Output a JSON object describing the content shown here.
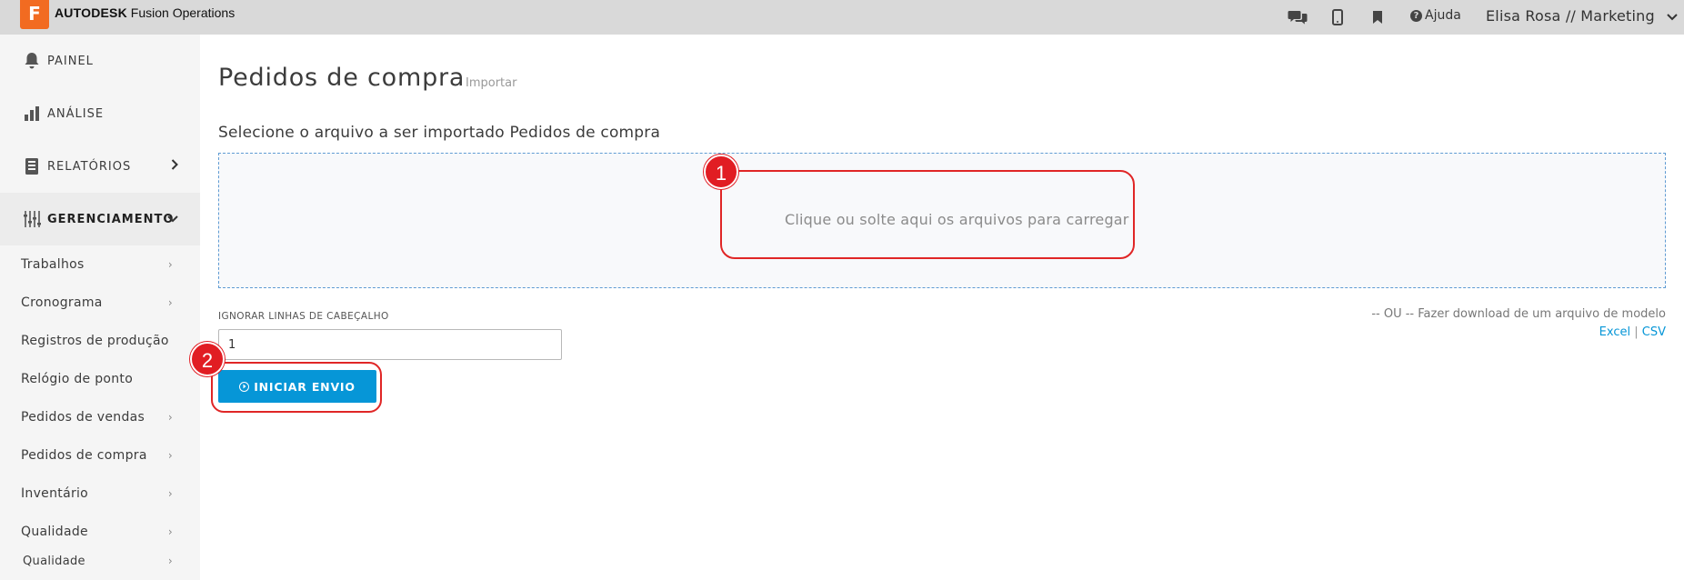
{
  "topbar": {
    "logo_letter": "F",
    "brand_main": "AUTODESK",
    "brand_product": "Fusion Operations",
    "help_label": "Ajuda",
    "user_label": "Elisa Rosa // Marketing",
    "icons": [
      "chat-icon",
      "mobile-icon",
      "bookmark-icon",
      "help-icon",
      "chevron-down-icon"
    ]
  },
  "sidebar": {
    "main": [
      {
        "label": "PAINEL",
        "icon": "bell-icon"
      },
      {
        "label": "ANÁLISE",
        "icon": "bar-chart-icon"
      },
      {
        "label": "RELATÓRIOS",
        "icon": "book-icon"
      },
      {
        "label": "GERENCIAMENTO",
        "icon": "sliders-icon"
      }
    ],
    "sub": [
      {
        "label": "Trabalhos",
        "arrow": true
      },
      {
        "label": "Cronograma",
        "arrow": true
      },
      {
        "label": "Registros de produção",
        "arrow": false
      },
      {
        "label": "Relógio de ponto",
        "arrow": false
      },
      {
        "label": "Pedidos de vendas",
        "arrow": true
      },
      {
        "label": "Pedidos de compra",
        "arrow": true
      },
      {
        "label": "Inventário",
        "arrow": true
      },
      {
        "label": "Qualidade",
        "arrow": true
      },
      {
        "label": "Qualidade",
        "arrow": true
      }
    ]
  },
  "main": {
    "title": "Pedidos de compra",
    "subtitle": "Importar",
    "section_label": "Selecione o arquivo a ser importado Pedidos de compra",
    "dropzone_text": "Clique ou solte aqui os arquivos para carregar",
    "ignore_label": "IGNORAR LINHAS DE CABEÇALHO",
    "ignore_value": "1",
    "start_button": "INICIAR ENVIO",
    "model_text": "-- OU -- Fazer download de um arquivo de modelo",
    "model_excel": "Excel",
    "model_sep": "|",
    "model_csv": "CSV"
  },
  "annotations": {
    "num1": "1",
    "num2": "2",
    "color": "#e11d23"
  },
  "colors": {
    "accent": "#0696d7",
    "logo": "#f26b21"
  }
}
